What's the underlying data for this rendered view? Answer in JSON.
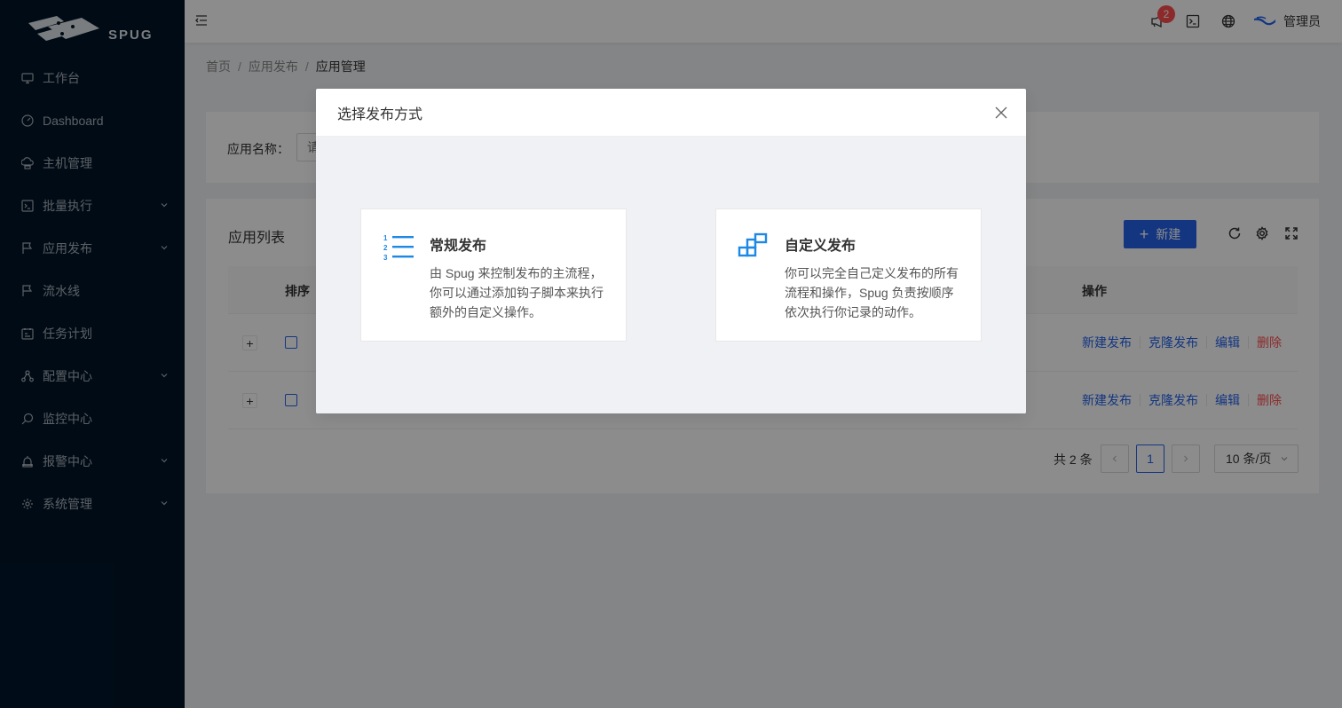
{
  "sidebar": {
    "logo_text": "SPUG",
    "items": [
      {
        "label": "工作台",
        "icon": "desktop-icon",
        "has_children": false
      },
      {
        "label": "Dashboard",
        "icon": "dashboard-icon",
        "has_children": false
      },
      {
        "label": "主机管理",
        "icon": "cloud-server-icon",
        "has_children": false
      },
      {
        "label": "批量执行",
        "icon": "terminal-icon",
        "has_children": true
      },
      {
        "label": "应用发布",
        "icon": "flag-icon",
        "has_children": true
      },
      {
        "label": "流水线",
        "icon": "flag-icon",
        "has_children": false
      },
      {
        "label": "任务计划",
        "icon": "schedule-icon",
        "has_children": false
      },
      {
        "label": "配置中心",
        "icon": "deployment-icon",
        "has_children": true
      },
      {
        "label": "监控中心",
        "icon": "monitor-icon",
        "has_children": false
      },
      {
        "label": "报警中心",
        "icon": "alert-icon",
        "has_children": true
      },
      {
        "label": "系统管理",
        "icon": "setting-icon",
        "has_children": true
      }
    ]
  },
  "header": {
    "notification_count": "2",
    "user_name": "管理员"
  },
  "breadcrumb": [
    "首页",
    "应用发布",
    "应用管理"
  ],
  "search": {
    "label": "应用名称：",
    "placeholder": "请输入"
  },
  "table": {
    "title": "应用列表",
    "new_button": "新建",
    "columns": [
      "排序",
      "操作"
    ],
    "rows": [
      {
        "actions": [
          "新建发布",
          "克隆发布",
          "编辑",
          "删除"
        ]
      },
      {
        "actions": [
          "新建发布",
          "克隆发布",
          "编辑",
          "删除"
        ]
      }
    ],
    "pagination": {
      "total": "共 2 条",
      "current_page": "1",
      "page_size": "10 条/页"
    }
  },
  "modal": {
    "title": "选择发布方式",
    "options": [
      {
        "title": "常规发布",
        "description": "由 Spug 来控制发布的主流程，你可以通过添加钩子脚本来执行额外的自定义操作。",
        "icon": "ordered-list-icon"
      },
      {
        "title": "自定义发布",
        "description": "你可以完全自己定义发布的所有流程和操作，Spug 负责按顺序依次执行你记录的动作。",
        "icon": "build-icon"
      }
    ]
  },
  "colors": {
    "primary": "#2563eb",
    "danger": "#ff4d4f",
    "sidebar_bg": "#001529",
    "option_icon": "#1e88e5"
  }
}
